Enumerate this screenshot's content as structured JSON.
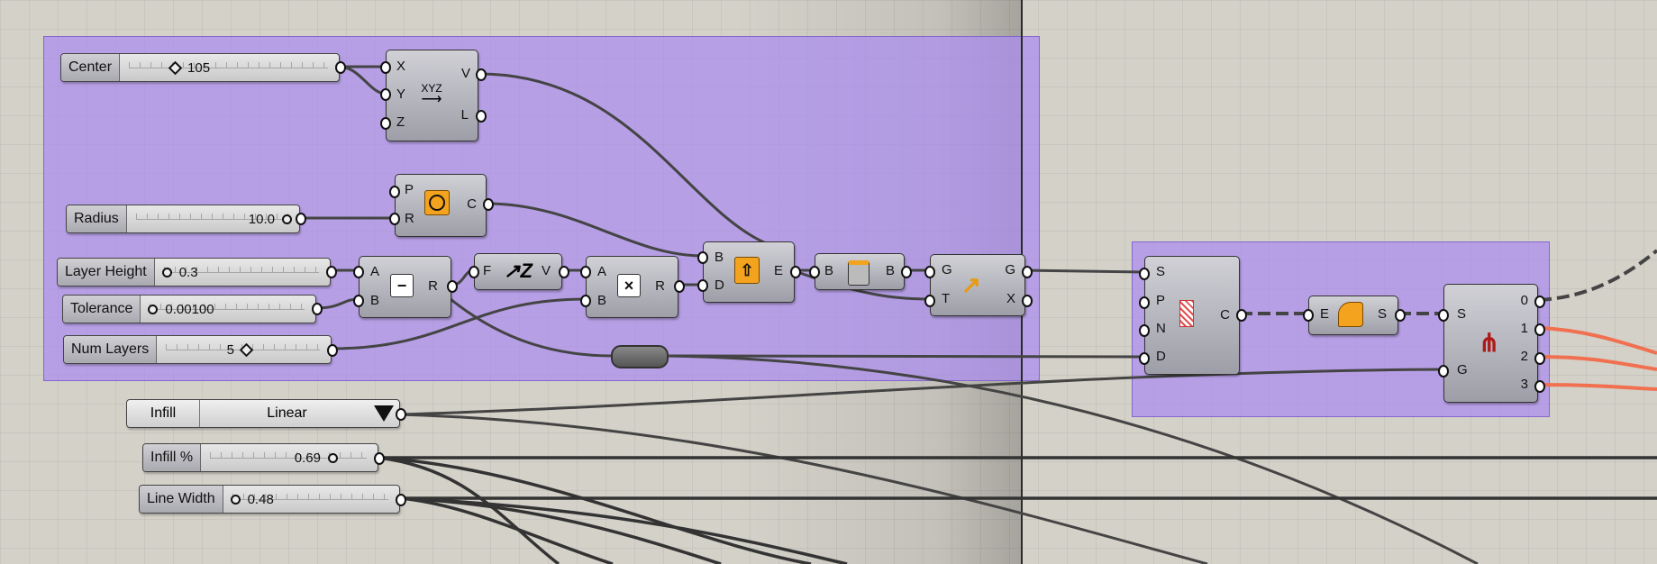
{
  "sliders": {
    "center": {
      "label": "Center",
      "value": "105"
    },
    "radius": {
      "label": "Radius",
      "value": "10.0"
    },
    "layer_height": {
      "label": "Layer Height",
      "value": "0.3"
    },
    "tolerance": {
      "label": "Tolerance",
      "value": "0.00100"
    },
    "num_layers": {
      "label": "Num Layers",
      "value": "5"
    },
    "infill_pct": {
      "label": "Infill %",
      "value": "0.69"
    },
    "line_width": {
      "label": "Line Width",
      "value": "0.48"
    }
  },
  "dropdown": {
    "label": "Infill",
    "value": "Linear"
  },
  "components": {
    "construct_point": {
      "inputs": [
        "X",
        "Y",
        "Z"
      ],
      "outputs": [
        "V",
        "L"
      ],
      "icon_text": "XYZ"
    },
    "circle": {
      "inputs": [
        "P",
        "R"
      ],
      "outputs": [
        "C"
      ]
    },
    "subtract": {
      "inputs": [
        "A",
        "B"
      ],
      "outputs": [
        "R"
      ],
      "symbol": "−"
    },
    "unit_z": {
      "inputs": [
        "F"
      ],
      "outputs": [
        "V"
      ],
      "symbol": "Z"
    },
    "multiply": {
      "inputs": [
        "A",
        "B"
      ],
      "outputs": [
        "R"
      ],
      "symbol": "×"
    },
    "extrude": {
      "inputs": [
        "B",
        "D"
      ],
      "outputs": [
        "E"
      ]
    },
    "cap": {
      "inputs": [
        "B"
      ],
      "outputs": [
        "B"
      ]
    },
    "move": {
      "inputs": [
        "G",
        "T"
      ],
      "outputs": [
        "G",
        "X"
      ]
    },
    "contour": {
      "inputs": [
        "S",
        "P",
        "N",
        "D"
      ],
      "outputs": [
        "C"
      ]
    },
    "boundary": {
      "inputs": [
        "E"
      ],
      "outputs": [
        "S"
      ]
    },
    "stream_filter": {
      "inputs": [
        "S",
        "G"
      ],
      "outputs": [
        "0",
        "1",
        "2",
        "3"
      ]
    }
  },
  "colors": {
    "group": "#aa8cf0",
    "wire": "#444444",
    "wire_orange": "#f07050",
    "canvas": "#d4d1c9"
  }
}
